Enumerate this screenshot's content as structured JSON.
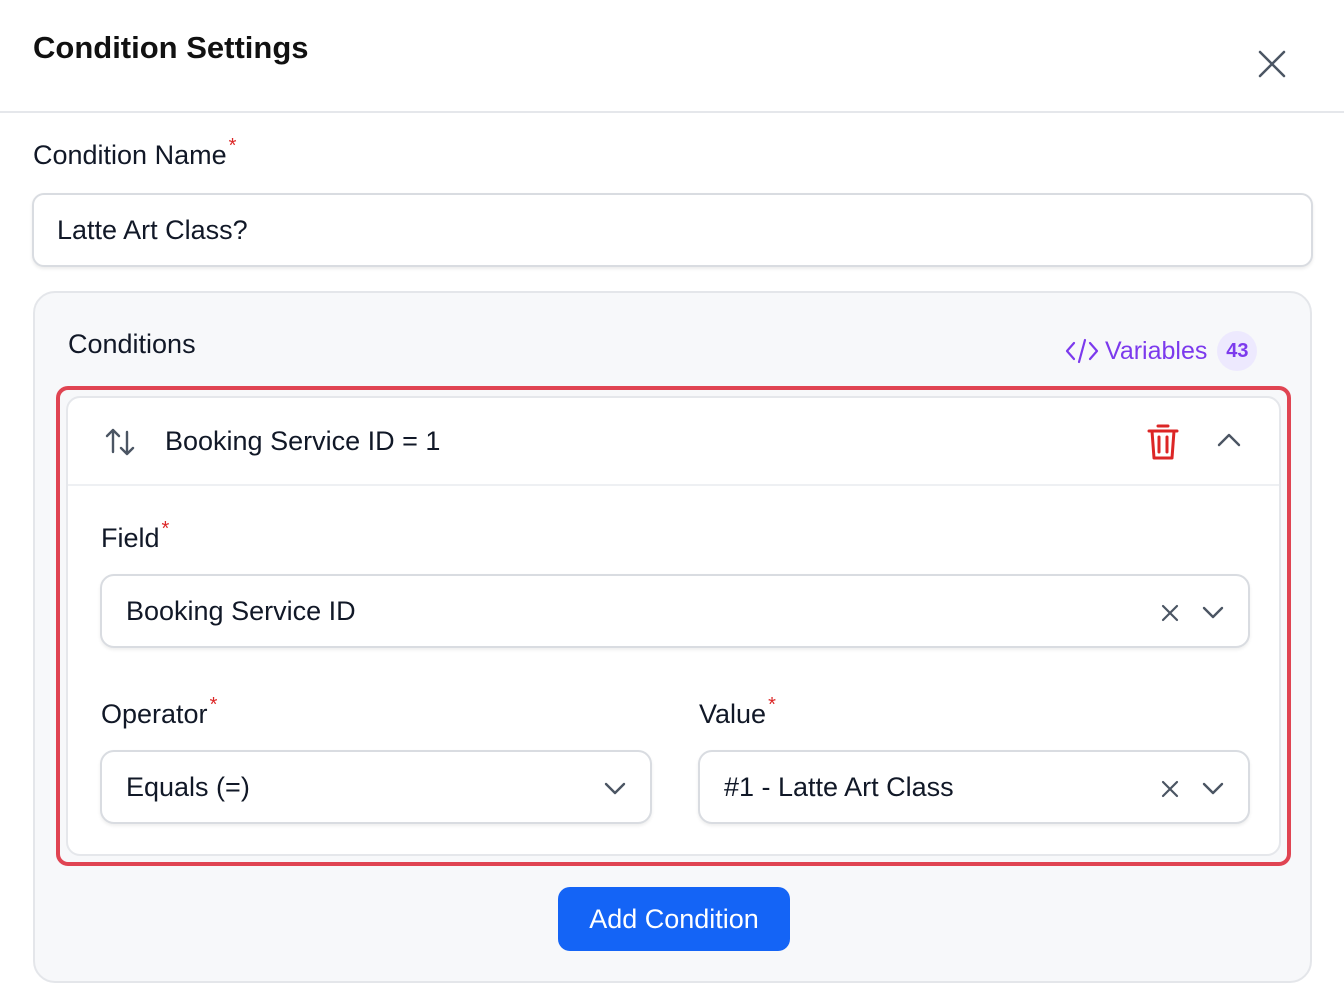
{
  "header": {
    "title": "Condition Settings"
  },
  "condition_name": {
    "label": "Condition Name",
    "required_mark": "*",
    "value": "Latte Art Class?"
  },
  "conditions": {
    "title": "Conditions",
    "variables": {
      "label": "Variables",
      "count": "43"
    },
    "item": {
      "summary": "Booking Service ID = 1",
      "field": {
        "label": "Field",
        "required_mark": "*",
        "value": "Booking Service ID"
      },
      "operator": {
        "label": "Operator",
        "required_mark": "*",
        "value": "Equals (=)"
      },
      "value": {
        "label": "Value",
        "required_mark": "*",
        "value": "#1 - Latte Art Class"
      }
    },
    "add_button": "Add Condition"
  },
  "colors": {
    "accent": "#1464f6",
    "variables": "#7c3aed",
    "danger": "#dc2626",
    "highlight": "#e04452"
  }
}
